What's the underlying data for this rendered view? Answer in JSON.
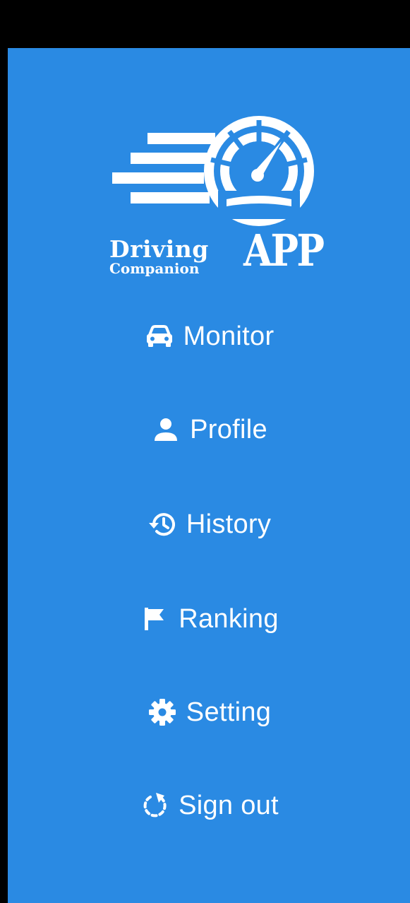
{
  "brand": {
    "line1": "Driving",
    "line2": "Companion",
    "suffix": "APP"
  },
  "colors": {
    "drawer_background": "#2a8ae3",
    "status_bar": "#000000",
    "foreground": "#ffffff"
  },
  "menu": {
    "items": [
      {
        "label": "Monitor",
        "icon": "car-icon"
      },
      {
        "label": "Profile",
        "icon": "person-icon"
      },
      {
        "label": "History",
        "icon": "history-icon"
      },
      {
        "label": "Ranking",
        "icon": "flag-icon"
      },
      {
        "label": "Setting",
        "icon": "gear-icon"
      },
      {
        "label": "Sign out",
        "icon": "sign-out-icon"
      }
    ]
  }
}
